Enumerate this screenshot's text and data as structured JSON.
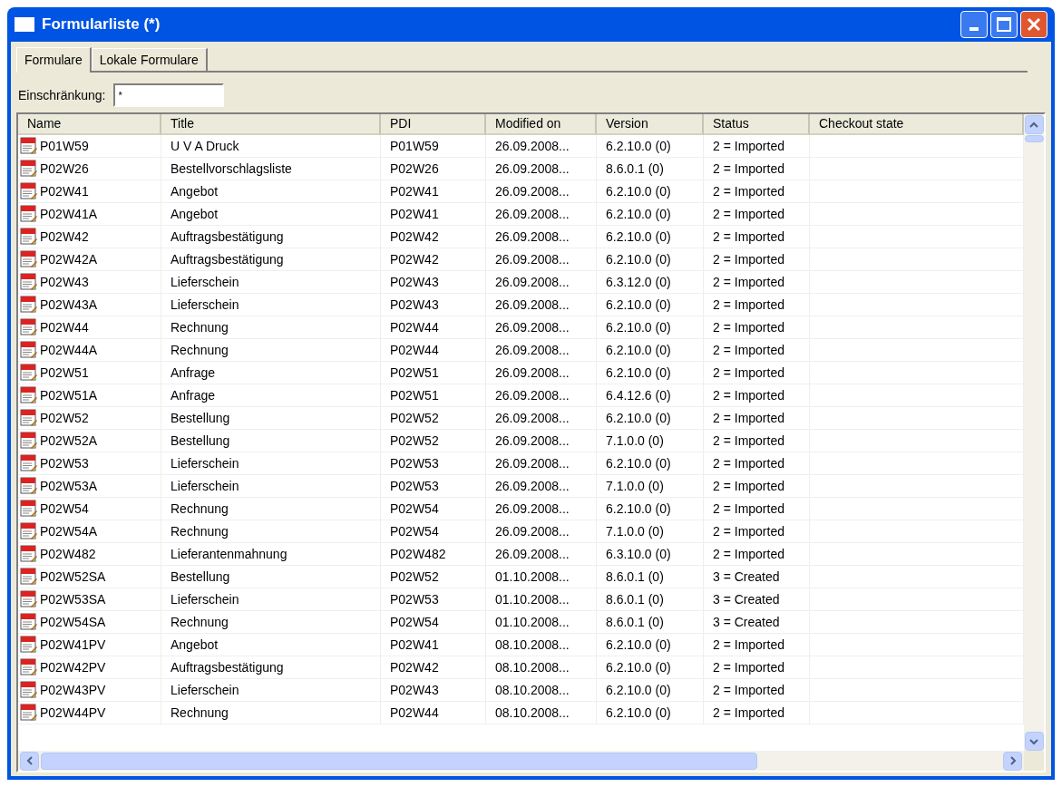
{
  "window": {
    "title": "Formularliste (*)"
  },
  "tabs": [
    {
      "label": "Formulare",
      "selected": true
    },
    {
      "label": "Lokale Formulare",
      "selected": false
    }
  ],
  "filter": {
    "label": "Einschränkung:",
    "value": "*"
  },
  "table": {
    "columns": [
      "Name",
      "Title",
      "PDI",
      "Modified on",
      "Version",
      "Status",
      "Checkout state"
    ],
    "rows": [
      [
        "P01W59",
        "U V A  Druck",
        "P01W59",
        "26.09.2008...",
        "6.2.10.0 (0)",
        "2 = Imported"
      ],
      [
        "P02W26",
        "Bestellvorschlagsliste",
        "P02W26",
        "26.09.2008...",
        "8.6.0.1 (0)",
        "2 = Imported"
      ],
      [
        "P02W41",
        "Angebot",
        "P02W41",
        "26.09.2008...",
        "6.2.10.0 (0)",
        "2 = Imported"
      ],
      [
        "P02W41A",
        "Angebot",
        "P02W41",
        "26.09.2008...",
        "6.2.10.0 (0)",
        "2 = Imported"
      ],
      [
        "P02W42",
        "Auftragsbestätigung",
        "P02W42",
        "26.09.2008...",
        "6.2.10.0 (0)",
        "2 = Imported"
      ],
      [
        "P02W42A",
        "Auftragsbestätigung",
        "P02W42",
        "26.09.2008...",
        "6.2.10.0 (0)",
        "2 = Imported"
      ],
      [
        "P02W43",
        "Lieferschein",
        "P02W43",
        "26.09.2008...",
        "6.3.12.0 (0)",
        "2 = Imported"
      ],
      [
        "P02W43A",
        "Lieferschein",
        "P02W43",
        "26.09.2008...",
        "6.2.10.0 (0)",
        "2 = Imported"
      ],
      [
        "P02W44",
        "Rechnung",
        "P02W44",
        "26.09.2008...",
        "6.2.10.0 (0)",
        "2 = Imported"
      ],
      [
        "P02W44A",
        "Rechnung",
        "P02W44",
        "26.09.2008...",
        "6.2.10.0 (0)",
        "2 = Imported"
      ],
      [
        "P02W51",
        "Anfrage",
        "P02W51",
        "26.09.2008...",
        "6.2.10.0 (0)",
        "2 = Imported"
      ],
      [
        "P02W51A",
        "Anfrage",
        "P02W51",
        "26.09.2008...",
        "6.4.12.6 (0)",
        "2 = Imported"
      ],
      [
        "P02W52",
        "Bestellung",
        "P02W52",
        "26.09.2008...",
        "6.2.10.0 (0)",
        "2 = Imported"
      ],
      [
        "P02W52A",
        "Bestellung",
        "P02W52",
        "26.09.2008...",
        "7.1.0.0 (0)",
        "2 = Imported"
      ],
      [
        "P02W53",
        "Lieferschein",
        "P02W53",
        "26.09.2008...",
        "6.2.10.0 (0)",
        "2 = Imported"
      ],
      [
        "P02W53A",
        "Lieferschein",
        "P02W53",
        "26.09.2008...",
        "7.1.0.0 (0)",
        "2 = Imported"
      ],
      [
        "P02W54",
        "Rechnung",
        "P02W54",
        "26.09.2008...",
        "6.2.10.0 (0)",
        "2 = Imported"
      ],
      [
        "P02W54A",
        "Rechnung",
        "P02W54",
        "26.09.2008...",
        "7.1.0.0 (0)",
        "2 = Imported"
      ],
      [
        "P02W482",
        "Lieferantenmahnung",
        "P02W482",
        "26.09.2008...",
        "6.3.10.0 (0)",
        "2 = Imported"
      ],
      [
        "P02W52SA",
        "Bestellung",
        "P02W52",
        "01.10.2008...",
        "8.6.0.1 (0)",
        "3 = Created"
      ],
      [
        "P02W53SA",
        "Lieferschein",
        "P02W53",
        "01.10.2008...",
        "8.6.0.1 (0)",
        "3 = Created"
      ],
      [
        "P02W54SA",
        "Rechnung",
        "P02W54",
        "01.10.2008...",
        "8.6.0.1 (0)",
        "3 = Created"
      ],
      [
        "P02W41PV",
        "Angebot",
        "P02W41",
        "08.10.2008...",
        "6.2.10.0 (0)",
        "2 = Imported"
      ],
      [
        "P02W42PV",
        "Auftragsbestätigung",
        "P02W42",
        "08.10.2008...",
        "6.2.10.0 (0)",
        "2 = Imported"
      ],
      [
        "P02W43PV",
        "Lieferschein",
        "P02W43",
        "08.10.2008...",
        "6.2.10.0 (0)",
        "2 = Imported"
      ],
      [
        "P02W44PV",
        "Rechnung",
        "P02W44",
        "08.10.2008...",
        "6.2.10.0 (0)",
        "2 = Imported"
      ]
    ]
  }
}
